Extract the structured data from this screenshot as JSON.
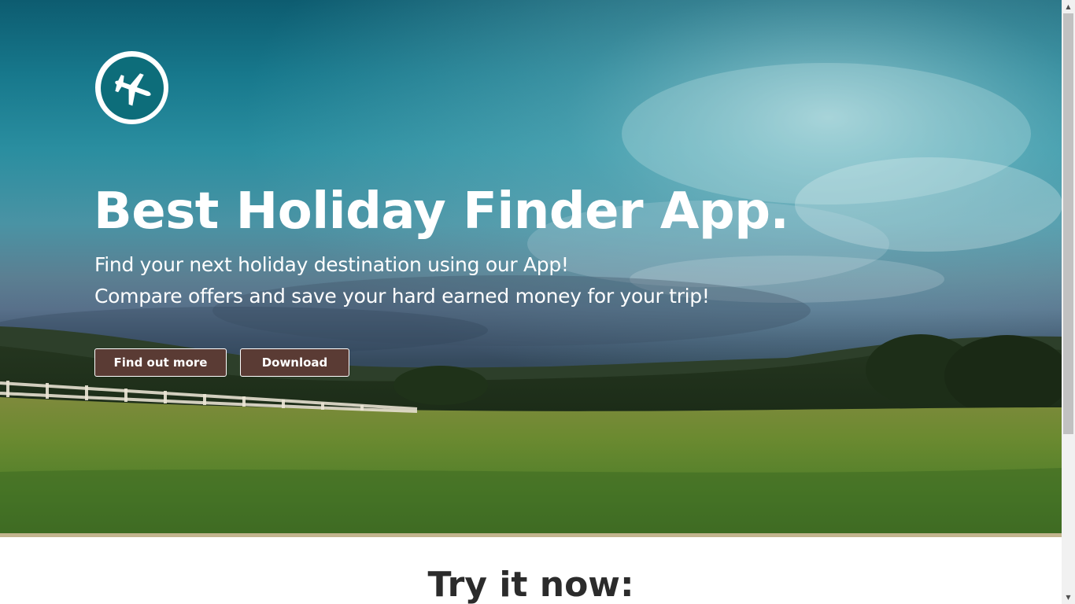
{
  "hero": {
    "logo": {
      "icon": "airplane-icon"
    },
    "headline": "Best Holiday Finder App.",
    "subline_1": "Find your next holiday destination using our App!",
    "subline_2": "Compare offers and save your hard earned money for your trip!",
    "buttons": {
      "find_out_more": "Find out more",
      "download": "Download"
    }
  },
  "section": {
    "title": "Try it now:"
  },
  "colors": {
    "button_bg": "#5a3b34",
    "logo_bg": "#0d6d7a",
    "accent_bar": "#c2b48e"
  },
  "scrollbar": {
    "up_icon": "scroll-up-arrow-icon",
    "down_icon": "scroll-down-arrow-icon"
  }
}
